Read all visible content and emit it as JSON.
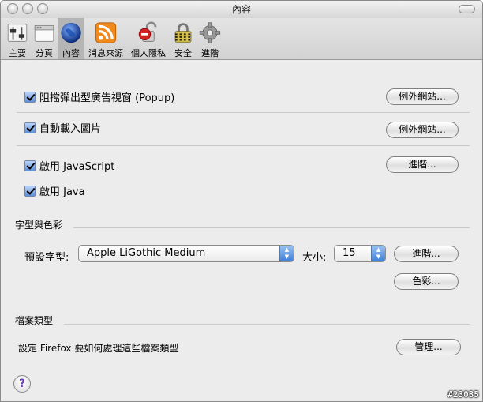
{
  "window": {
    "title": "內容"
  },
  "toolbar": {
    "items": [
      {
        "label": "主要",
        "icon": "toggles-icon"
      },
      {
        "label": "分頁",
        "icon": "tabs-window-icon"
      },
      {
        "label": "內容",
        "icon": "globe-icon",
        "selected": true
      },
      {
        "label": "消息來源",
        "icon": "rss-feed-icon"
      },
      {
        "label": "個人隱私",
        "icon": "privacy-lock-icon"
      },
      {
        "label": "安全",
        "icon": "security-padlock-icon"
      },
      {
        "label": "進階",
        "icon": "gear-icon"
      }
    ]
  },
  "content": {
    "popup": {
      "label": "阻擋彈出型廣告視窗 (Popup)",
      "checked": true,
      "button": "例外網站..."
    },
    "images": {
      "label": "自動載入圖片",
      "checked": true,
      "button": "例外網站..."
    },
    "javascript": {
      "label": "啟用 JavaScript",
      "checked": true,
      "button": "進階..."
    },
    "java": {
      "label": "啟用 Java",
      "checked": true
    },
    "fonts": {
      "section_title": "字型與色彩",
      "default_font_label": "預設字型:",
      "default_font_value": "Apple LiGothic Medium",
      "size_label": "大小:",
      "size_value": "15",
      "advanced_button": "進階...",
      "colors_button": "色彩..."
    },
    "filetypes": {
      "section_title": "檔案類型",
      "description": "設定 Firefox 要如何處理這些檔案類型",
      "manage_button": "管理..."
    }
  },
  "help_glyph": "?",
  "watermark": "#23035",
  "colors": {
    "accent": "#3f7fd7",
    "selected_tab": "#b5b5b5",
    "window_bg": "#ececec"
  }
}
